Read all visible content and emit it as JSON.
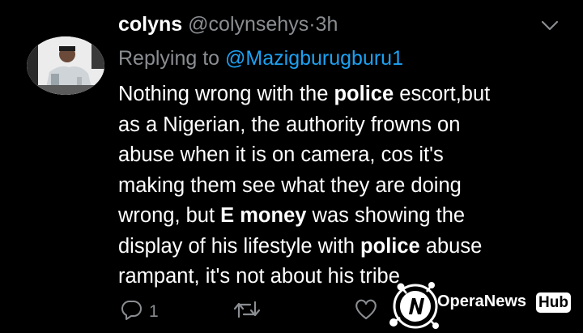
{
  "tweet": {
    "author_name": "colyns",
    "author_handle": "@colynsehys",
    "separator": "·",
    "time": "3h",
    "reply_prefix": "Replying to",
    "reply_mention": "@Mazigburugburu1",
    "body_lines": [
      [
        {
          "t": "Nothing wrong with the "
        },
        {
          "t": "police",
          "b": true
        },
        {
          "t": " escort,but"
        }
      ],
      [
        {
          "t": "as a Nigerian, the authority frowns on"
        }
      ],
      [
        {
          "t": "abuse when it is on camera, cos it's"
        }
      ],
      [
        {
          "t": "making them see what they are doing"
        }
      ],
      [
        {
          "t": "wrong, but "
        },
        {
          "t": "E money",
          "b": true
        },
        {
          "t": " was showing the"
        }
      ],
      [
        {
          "t": "display of his lifestyle with "
        },
        {
          "t": "police",
          "b": true
        },
        {
          "t": " abuse"
        }
      ],
      [
        {
          "t": "rampant, it's not about his tribe"
        }
      ]
    ],
    "reply_count": "1"
  },
  "icons": {
    "avatar": "avatar-photo",
    "more": "chevron-down-icon",
    "reply": "reply-icon",
    "retweet": "retweet-icon",
    "like": "heart-icon"
  },
  "watermark": {
    "brand": "OperaNews",
    "badge": "Hub"
  },
  "colors": {
    "background": "#000000",
    "muted": "#8a8d91",
    "mention": "#1da1f2"
  }
}
